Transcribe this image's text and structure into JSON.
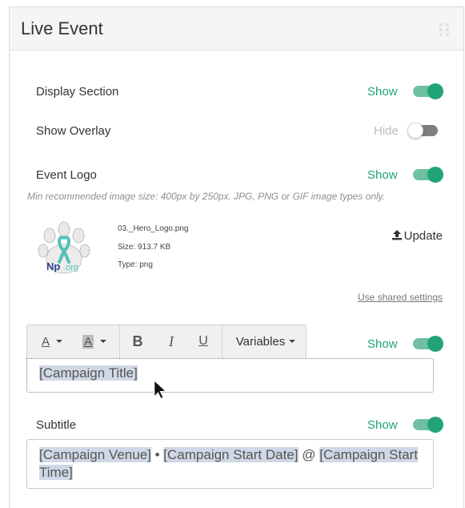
{
  "panel": {
    "title": "Live Event"
  },
  "rows": {
    "display_section": {
      "label": "Display Section",
      "state_text": "Show",
      "on": true,
      "color": "#20a476"
    },
    "show_overlay": {
      "label": "Show Overlay",
      "state_text": "Hide",
      "on": false,
      "color": "#bbbbbb"
    },
    "event_logo": {
      "label": "Event Logo",
      "state_text": "Show",
      "on": true,
      "color": "#20a476"
    },
    "title_field": {
      "state_text": "Show",
      "on": true,
      "color": "#20a476"
    },
    "subtitle": {
      "label": "Subtitle",
      "state_text": "Show",
      "on": true,
      "color": "#20a476"
    }
  },
  "logo": {
    "hint": "Min recommended image size: 400px by 250px. JPG, PNG or GIF image types only.",
    "file_name": "03._Hero_Logo.png",
    "size": "Size: 913.7 KB",
    "type": "Type: png",
    "update_label": "Update",
    "shared_settings_label": "Use shared settings",
    "logo_text": "Np.org"
  },
  "toolbar": {
    "font_color_label": "A",
    "bg_color_label": "A",
    "bold_label": "B",
    "italic_label": "I",
    "underline_label": "U",
    "variables_label": "Variables"
  },
  "title_editor": {
    "token": "[Campaign Title]"
  },
  "subtitle_editor": {
    "token_venue": "[Campaign Venue]",
    "sep1": " • ",
    "token_start_date": "[Campaign Start Date]",
    "sep2": " @ ",
    "token_start_time": "[Campaign Start Time]"
  }
}
